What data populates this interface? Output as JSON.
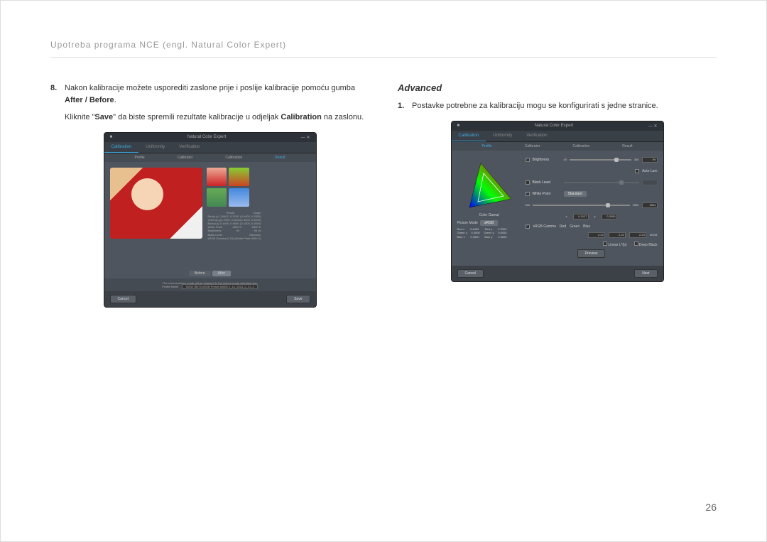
{
  "header": "Upotreba programa NCE (engl. Natural Color Expert)",
  "page_number": "26",
  "left": {
    "item_num": "8.",
    "item_text_a": "Nakon kalibracije možete usporediti zaslone prije i poslije kalibracije pomoću gumba ",
    "item_bold_a": "After / Before",
    "item_text_a_end": ".",
    "indent_a": "Kliknite \"",
    "indent_bold": "Save",
    "indent_mid": "\" da biste spremili rezultate kalibracije u odjeljak ",
    "indent_bold2": "Calibration",
    "indent_end": " na zaslonu."
  },
  "right": {
    "title": "Advanced",
    "item_num": "1.",
    "item_text": "Postavke potrebne za kalibraciju mogu se konfigurirati s jedne stranice."
  },
  "shot1": {
    "app_title": "Natural Color Expert",
    "tabs": [
      "Calibration",
      "Uniformity",
      "Verification"
    ],
    "subtabs": [
      "Profile",
      "Calibrator",
      "Calibration",
      "Result"
    ],
    "before": "Before",
    "after": "After",
    "result_cols": [
      "",
      "Result",
      "Target"
    ],
    "results": [
      [
        "Red(x,y)",
        "0.6402, 0.3298",
        "(0.6400, 0.3300)"
      ],
      [
        "Green(x,y)",
        "0.2999, 0.6001",
        "(0.3000, 0.6000)"
      ],
      [
        "Blue(x,y)",
        "0.1500, 0.0600",
        "(0.1500, 0.0600)"
      ],
      [
        "White Point",
        "6500 K",
        "6500 K"
      ],
      [
        "Brightness",
        "99",
        "99 cd"
      ],
      [
        "Black Level",
        "Minimum",
        ""
      ],
      [
        "sRGB Gamma",
        "(2.20) (White Point 6500 K)",
        ""
      ]
    ],
    "note": "The current picture mode will be changed to the picture mode selected now.",
    "profile_label": "Profile Name",
    "profile_value": "SMS27B970  sRGB Preset 6500K  2_12_2014_2_21_2",
    "cancel": "Cancel",
    "save": "Save"
  },
  "shot2": {
    "app_title": "Natural Color Expert",
    "tabs": [
      "Calibration",
      "Uniformity",
      "Verification"
    ],
    "subtabs": [
      "Profile",
      "Calibrator",
      "Calibration",
      "Result"
    ],
    "brightness_label": "Brightness",
    "brightness_val": "99",
    "autolum": "Auto Lum",
    "black_label": "Black Level",
    "white_label": "White Point",
    "white_dd": "Standard",
    "color_gamut": "Color Gamut",
    "picture_mode": "Picture Mode",
    "picture_dd": "sRGB",
    "x_vals": [
      "40",
      "300",
      "600",
      "4500"
    ],
    "x_main": "0.3127",
    "y_main": "0.3290",
    "K": "6504",
    "coords": [
      [
        "Red x",
        "0.6400",
        "Red y",
        "0.3300"
      ],
      [
        "Green x",
        "0.3000",
        "Green y",
        "0.6000"
      ],
      [
        "Blue x",
        "0.1500",
        "Blue y",
        "0.0600"
      ]
    ],
    "srgb_gamma": "sRGB Gamma",
    "rgb_labels": [
      "Red",
      "Green",
      "Blue"
    ],
    "rgb_vals": [
      "2.20",
      "2.20",
      "2.20"
    ],
    "linear": "Linear L*(b)",
    "deep": "Deep Black",
    "preview": "Preview",
    "cancel": "Cancel",
    "next": "Next"
  }
}
